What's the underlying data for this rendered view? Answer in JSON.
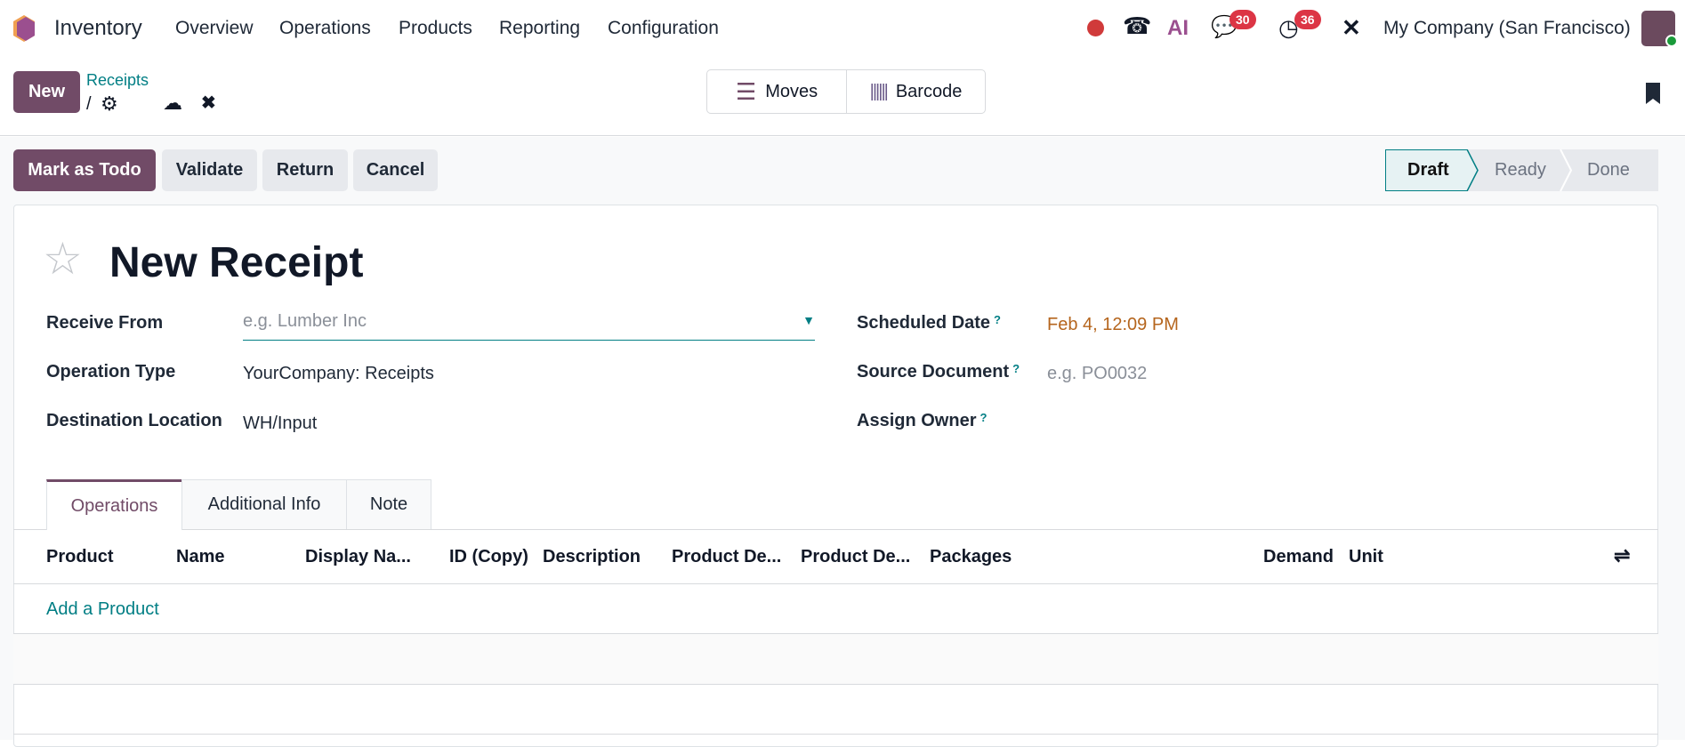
{
  "navbar": {
    "app_name": "Inventory",
    "menu": [
      "Overview",
      "Operations",
      "Products",
      "Reporting",
      "Configuration"
    ],
    "messages_count": "30",
    "activities_count": "36",
    "company": "My Company (San Francisco)",
    "ai_label": "AI"
  },
  "control_panel": {
    "new_label": "New",
    "breadcrumb": "Receipts",
    "breadcrumb_sep": "/",
    "moves_label": "Moves",
    "barcode_label": "Barcode"
  },
  "actions": {
    "mark_todo": "Mark as Todo",
    "validate": "Validate",
    "return": "Return",
    "cancel": "Cancel"
  },
  "statusbar": {
    "steps": [
      "Draft",
      "Ready",
      "Done"
    ],
    "active": "Draft"
  },
  "form": {
    "title": "New Receipt",
    "receive_from": {
      "label": "Receive From",
      "placeholder": "e.g. Lumber Inc"
    },
    "operation_type": {
      "label": "Operation Type",
      "value": "YourCompany: Receipts"
    },
    "destination": {
      "label": "Destination Location",
      "value": "WH/Input"
    },
    "scheduled_date": {
      "label": "Scheduled Date",
      "value": "Feb 4, 12:09 PM"
    },
    "source_document": {
      "label": "Source Document",
      "placeholder": "e.g. PO0032"
    },
    "assign_owner": {
      "label": "Assign Owner"
    },
    "help_mark": "?"
  },
  "tabs": [
    "Operations",
    "Additional Info",
    "Note"
  ],
  "table": {
    "columns": [
      "Product",
      "Name",
      "Display Na...",
      "ID (Copy)",
      "Description",
      "Product De...",
      "Product De...",
      "Packages",
      "Demand",
      "Unit"
    ],
    "add_label": "Add a Product"
  },
  "colors": {
    "primary": "#714b67",
    "link": "#017e84",
    "date": "#b5651d"
  }
}
